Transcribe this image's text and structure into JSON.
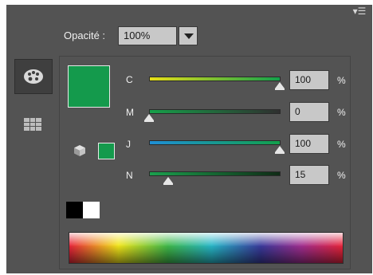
{
  "panel": {
    "menu_icon": "panel-menu-icon",
    "opacity": {
      "label": "Opacité :",
      "value": "100%"
    }
  },
  "tabs": [
    {
      "name": "color-palette",
      "icon": "palette-icon",
      "active": true
    },
    {
      "name": "swatches-grid",
      "icon": "grid-icon",
      "active": false
    }
  ],
  "colors": {
    "fill": "#149a4c",
    "stroke": "#149a4c"
  },
  "channels": [
    {
      "label": "C",
      "value": "100",
      "unit": "%",
      "level": 1.0
    },
    {
      "label": "M",
      "value": "0",
      "unit": "%",
      "level": 0.0
    },
    {
      "label": "J",
      "value": "100",
      "unit": "%",
      "level": 1.0
    },
    {
      "label": "N",
      "value": "15",
      "unit": "%",
      "level": 0.15
    }
  ]
}
